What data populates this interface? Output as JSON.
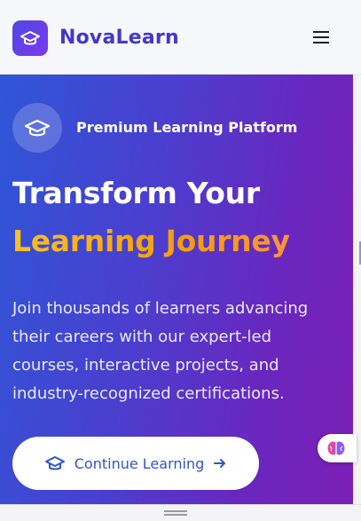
{
  "header": {
    "brand": "NovaLearn",
    "logo_icon": "graduation-cap-icon",
    "menu_icon": "hamburger-menu-icon"
  },
  "hero": {
    "badge_icon": "graduation-cap-icon",
    "badge_text": "Premium Learning Platform",
    "title_line1": "Transform Your",
    "title_line2": "Learning Journey",
    "description": "Join thousands of learners advancing their careers with our expert-led courses, interactive projects, and industry-recognized certifications.",
    "cta_label": "Continue Learning",
    "cta_icon": "graduation-cap-icon",
    "cta_arrow_icon": "arrow-right-icon"
  },
  "floating_widget": {
    "icon": "brain-icon"
  },
  "colors": {
    "brand": "#4338ca",
    "hero_gradient_start": "#2f56d6",
    "hero_gradient_end": "#7c1fb5",
    "highlight": "#fbbf24",
    "cta_text": "#2f56c6"
  }
}
